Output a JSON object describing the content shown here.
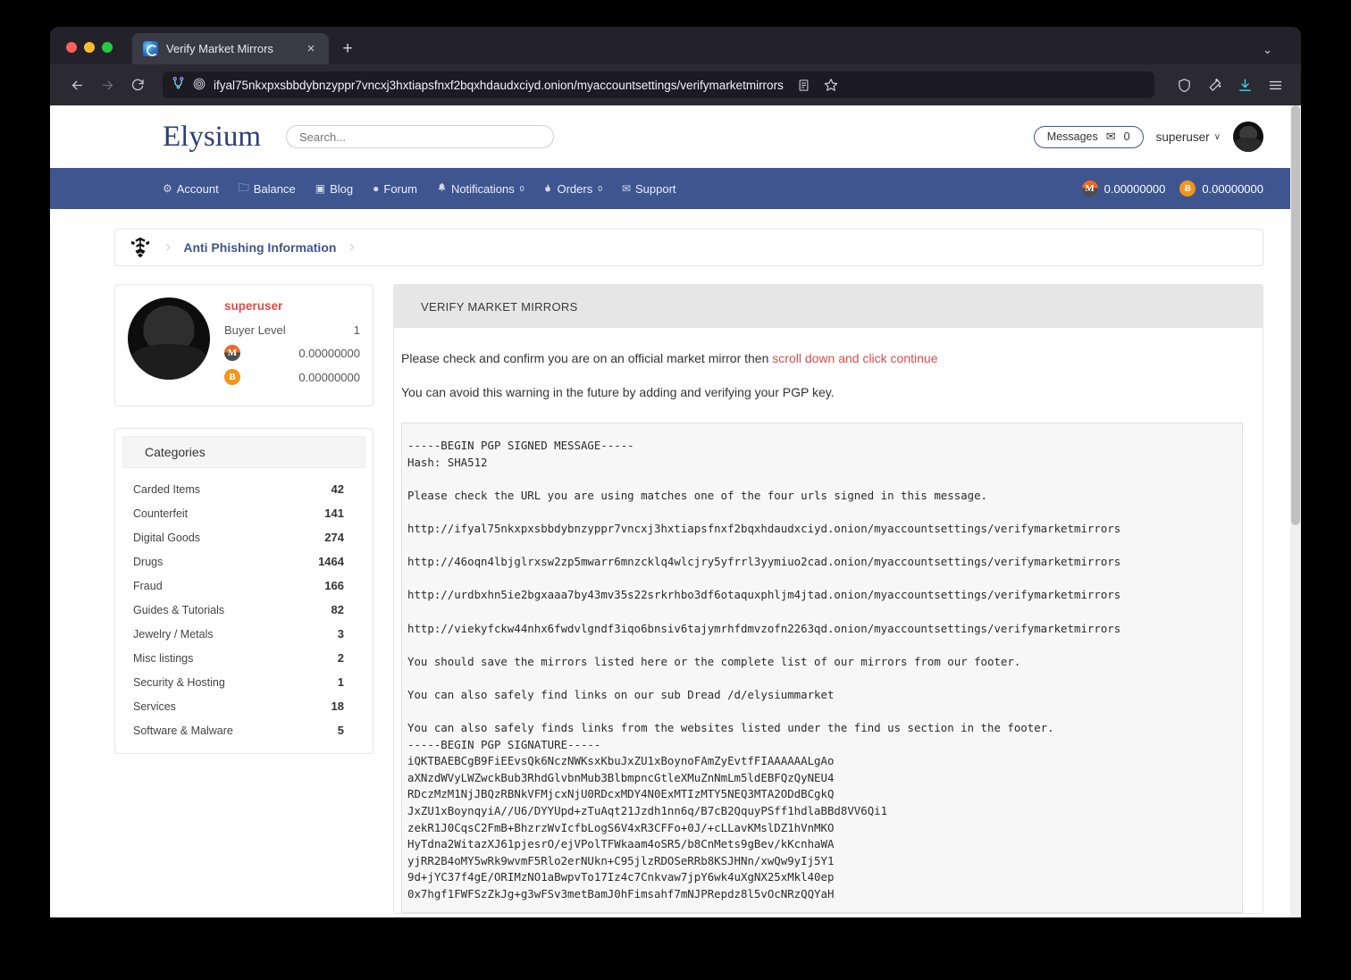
{
  "browser": {
    "tab_title": "Verify Market Mirrors",
    "favicon": "elysium-favicon-icon",
    "close_tab": "×",
    "new_tab": "+",
    "collapse_tabs": "⌄",
    "back": "←",
    "forward": "→",
    "reload": "↻",
    "url": "ifyal75nkxpxsbbdybnzyppr7vncxj3hxtiapsfnxf2bqxhdaudxciyd.onion/myaccountsettings/verifymarketmirrors",
    "circuit_icon": "tor-circuit-icon",
    "onion_icon": "onion-site-icon",
    "reader_icon": "☰",
    "bookmark_icon": "☆",
    "shield_icon": "shield-icon",
    "clean_icon": "new-identity-icon",
    "download_icon": "↓",
    "menu_icon": "≡"
  },
  "site": {
    "brand": "Elysium",
    "search": {
      "placeholder": "Search...",
      "value": ""
    },
    "messages": {
      "label": "Messages",
      "icon": "✉",
      "count": "0"
    },
    "user": {
      "name": "superuser",
      "caret": "∨",
      "avatar": "user-avatar"
    }
  },
  "nav": {
    "items": [
      {
        "label": "Account",
        "icon": "⚙",
        "icon_name": "gear-icon",
        "sup": ""
      },
      {
        "label": "Balance",
        "icon": "🗀",
        "icon_name": "wallet-icon",
        "sup": ""
      },
      {
        "label": "Blog",
        "icon": "▣",
        "icon_name": "blog-icon",
        "sup": ""
      },
      {
        "label": "Forum",
        "icon": "●",
        "icon_name": "comment-icon",
        "sup": ""
      },
      {
        "label": "Notifications",
        "icon": "🔔",
        "icon_name": "bell-icon",
        "sup": "0"
      },
      {
        "label": "Orders",
        "icon": "●",
        "icon_name": "fire-icon",
        "sup": "0"
      },
      {
        "label": "Support",
        "icon": "✉",
        "icon_name": "envelope-icon",
        "sup": ""
      }
    ],
    "balances": [
      {
        "coin": "XMR",
        "symbol": "M",
        "amount": "0.00000000"
      },
      {
        "coin": "BTC",
        "symbol": "Ƀ",
        "amount": "0.00000000"
      }
    ]
  },
  "breadcrumb": {
    "logo": "elysium-crest-icon",
    "separator": "›",
    "current": "Anti Phishing Information"
  },
  "profile": {
    "avatar": "profile-avatar",
    "username": "superuser",
    "level_label": "Buyer Level",
    "level_value": "1",
    "balances": [
      {
        "coin": "XMR",
        "symbol": "M",
        "amount": "0.00000000"
      },
      {
        "coin": "BTC",
        "symbol": "Ƀ",
        "amount": "0.00000000"
      }
    ]
  },
  "categories": {
    "title": "Categories",
    "items": [
      {
        "name": "Carded Items",
        "count": "42"
      },
      {
        "name": "Counterfeit",
        "count": "141"
      },
      {
        "name": "Digital Goods",
        "count": "274"
      },
      {
        "name": "Drugs",
        "count": "1464"
      },
      {
        "name": "Fraud",
        "count": "166"
      },
      {
        "name": "Guides & Tutorials",
        "count": "82"
      },
      {
        "name": "Jewelry / Metals",
        "count": "3"
      },
      {
        "name": "Misc listings",
        "count": "2"
      },
      {
        "name": "Security & Hosting",
        "count": "1"
      },
      {
        "name": "Services",
        "count": "18"
      },
      {
        "name": "Software & Malware",
        "count": "5"
      }
    ]
  },
  "main": {
    "panel_title": "VERIFY MARKET MIRRORS",
    "intro_prefix": "Please check and confirm you are on an official market mirror then ",
    "intro_link": "scroll down and click continue",
    "intro_second": "You can avoid this warning in the future by adding and verifying your PGP key.",
    "pgp_message": "-----BEGIN PGP SIGNED MESSAGE-----\nHash: SHA512\n\nPlease check the URL you are using matches one of the four urls signed in this message.\n\nhttp://ifyal75nkxpxsbbdybnzyppr7vncxj3hxtiapsfnxf2bqxhdaudxciyd.onion/myaccountsettings/verifymarketmirrors\n\nhttp://46oqn4lbjglrxsw2zp5mwarr6mnzcklq4wlcjry5yfrrl3yymiuo2cad.onion/myaccountsettings/verifymarketmirrors\n\nhttp://urdbxhn5ie2bgxaaa7by43mv35s22srkrhbo3df6otaquxphljm4jtad.onion/myaccountsettings/verifymarketmirrors\n\nhttp://viekyfckw44nhx6fwdvlgndf3iqo6bnsiv6tajymrhfdmvzofn2263qd.onion/myaccountsettings/verifymarketmirrors\n\nYou should save the mirrors listed here or the complete list of our mirrors from our footer.\n\nYou can also safely find links on our sub Dread /d/elysiummarket\n\nYou can also safely finds links from the websites listed under the find us section in the footer.\n-----BEGIN PGP SIGNATURE-----\n",
    "pgp_signature": "iQKTBAEBCgB9FiEEvsQk6NczNWKsxKbuJxZU1xBoynoFAmZyEvtfFIAAAAAALgAo\naXNzdWVyLWZwckBub3RhdGlvbnMub3BlbmpncGtleXMuZnNmLm5ldEBFQzQyNEU4\nRDczMzM1NjJBQzRBNkVFMjcxNjU0RDcxMDY4N0ExMTIzMTY5NEQ3MTA2ODdBCgkQ\nJxZU1xBoynqyiA//U6/DYYUpd+zTuAqt21Jzdh1nn6q/B7cB2QquyPSff1hdlaBBd8VV6Qi1\nzekR1J0CqsC2FmB+BhzrzWvIcfbLogS6V4xR3CFFo+0J/+cLLavKMslDZ1hVnMKO\nHyTdna2WitazXJ61pjesrO/ejVPolTFWkaam4oSR5/b8CnMets9gBev/kKcnhaWA\nyjRR2B4oMY5wRk9wvmF5Rlo2erNUkn+C95jlzRDOSeRRb8KSJHNn/xwQw9yIj5Y1\n9d+jYC37f4gE/ORIMzNO1aBwpvTo17Iz4c7Cnkvaw7jpY6wk4uXgNX25xMkl40ep\n0x7hgf1FWFSzZkJg+g3wFSv3metBamJ0hFimsahf7mNJPRepdz8l5vOcNRzQQYaH"
  },
  "colors": {
    "nav_blue": "#3e5590",
    "brand_blue": "#2d3e7a",
    "accent_red": "#e04b4b",
    "panel_gray": "#e6e6e6",
    "pgp_bg": "#f7f7f7"
  }
}
